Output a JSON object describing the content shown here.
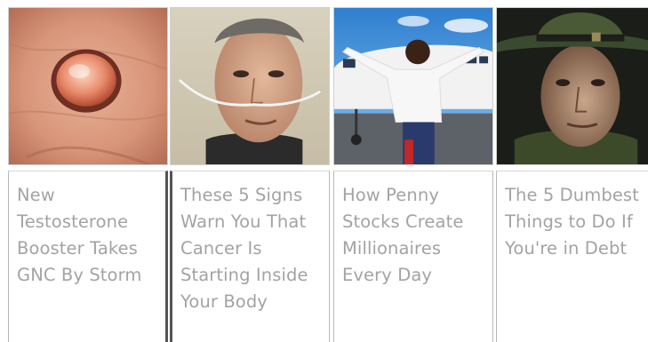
{
  "cards": [
    {
      "title": "New Testosterone Booster Takes GNC By Storm"
    },
    {
      "title": "These 5 Signs Warn You That Cancer Is Starting Inside Your Body"
    },
    {
      "title": "How Penny Stocks Create Millionaires Every Day"
    },
    {
      "title": "The 5 Dumbest Things to Do If You're in Debt"
    }
  ],
  "colors": {
    "caption_text": "#a3a3a3",
    "divider": "#555555",
    "border": "#b8b8b8"
  }
}
